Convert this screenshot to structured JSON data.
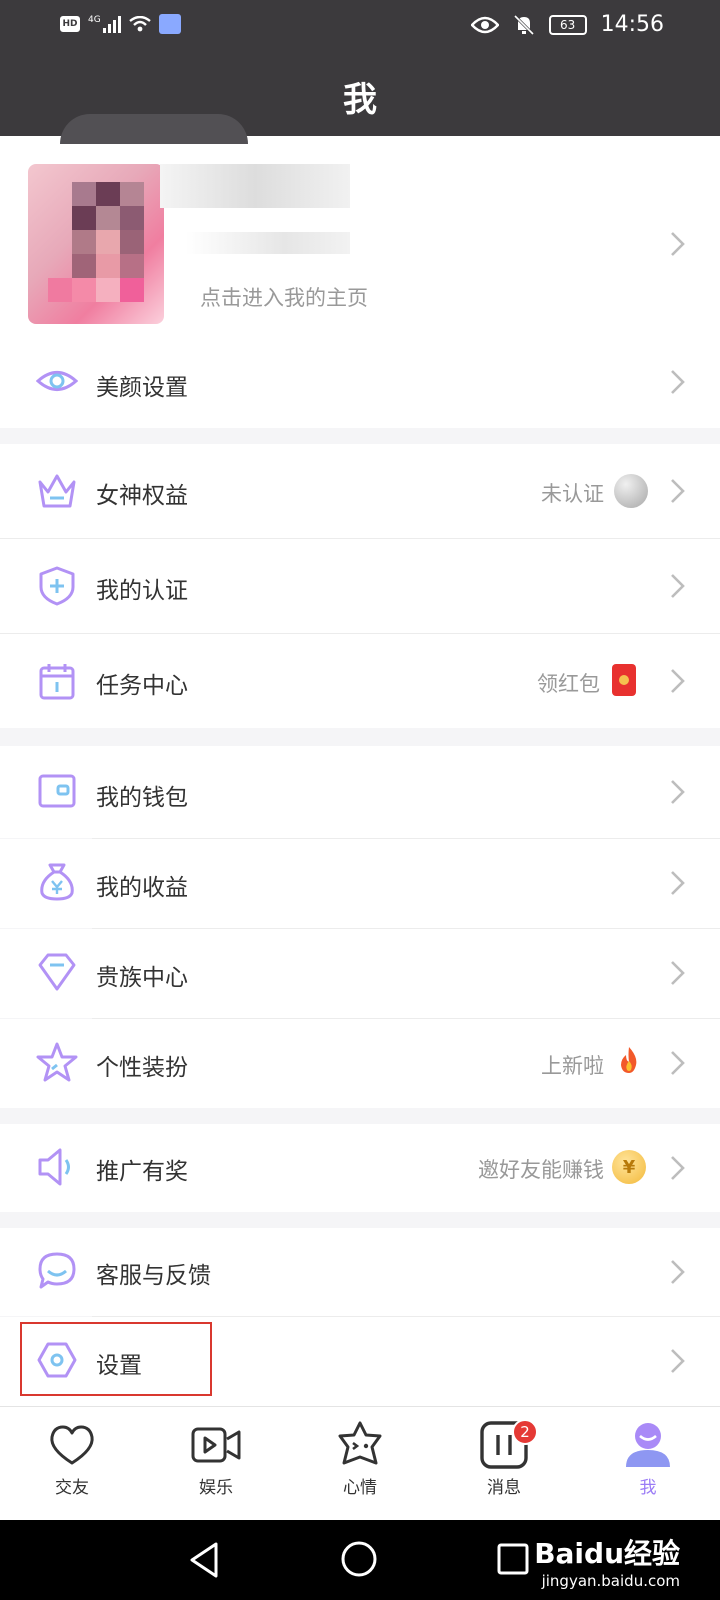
{
  "status_bar": {
    "time": "14:56",
    "battery": "63",
    "hd": "HD",
    "network": "4G"
  },
  "header": {
    "title": "我"
  },
  "profile": {
    "hint": "点击进入我的主页"
  },
  "menu": {
    "beauty": {
      "label": "美颜设置"
    },
    "goddess": {
      "label": "女神权益",
      "extra": "未认证"
    },
    "certify": {
      "label": "我的认证"
    },
    "tasks": {
      "label": "任务中心",
      "extra": "领红包"
    },
    "wallet": {
      "label": "我的钱包"
    },
    "income": {
      "label": "我的收益"
    },
    "noble": {
      "label": "贵族中心"
    },
    "dress": {
      "label": "个性装扮",
      "extra": "上新啦"
    },
    "promo": {
      "label": "推广有奖",
      "extra": "邀好友能赚钱"
    },
    "service": {
      "label": "客服与反馈"
    },
    "settings": {
      "label": "设置"
    }
  },
  "bottom_nav": {
    "items": [
      {
        "label": "交友"
      },
      {
        "label": "娱乐"
      },
      {
        "label": "心情"
      },
      {
        "label": "消息",
        "badge": "2"
      },
      {
        "label": "我"
      }
    ],
    "active": "我"
  },
  "watermark": {
    "main": "Baidu经验",
    "sub": "jingyan.baidu.com"
  },
  "colors": {
    "accent": "#9b7cf6",
    "header_bg": "#3c3a3d",
    "highlight": "#d9382f",
    "badge": "#e53935"
  }
}
